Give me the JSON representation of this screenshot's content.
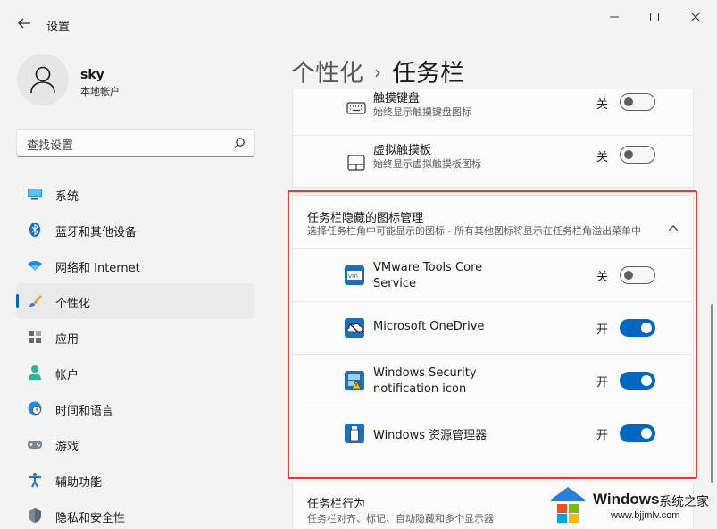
{
  "window": {
    "title": "设置"
  },
  "user": {
    "name": "sky",
    "type": "本地帐户"
  },
  "search": {
    "placeholder": "查找设置"
  },
  "nav": [
    {
      "label": "系统",
      "icon": "monitor-icon"
    },
    {
      "label": "蓝牙和其他设备",
      "icon": "bluetooth-icon"
    },
    {
      "label": "网络和 Internet",
      "icon": "wifi-icon"
    },
    {
      "label": "个性化",
      "icon": "brush-icon",
      "active": true
    },
    {
      "label": "应用",
      "icon": "apps-icon"
    },
    {
      "label": "帐户",
      "icon": "person-icon"
    },
    {
      "label": "时间和语言",
      "icon": "clock-globe-icon"
    },
    {
      "label": "游戏",
      "icon": "gamepad-icon"
    },
    {
      "label": "辅助功能",
      "icon": "accessibility-icon"
    },
    {
      "label": "隐私和安全性",
      "icon": "shield-icon"
    }
  ],
  "breadcrumb": {
    "parent": "个性化",
    "sep": "›",
    "current": "任务栏"
  },
  "top_rows": [
    {
      "title": "触摸键盘",
      "subtitle": "始终显示触摸键盘图标",
      "state": "关",
      "on": false
    },
    {
      "title": "虚拟触摸板",
      "subtitle": "始终显示虚拟触摸板图标",
      "state": "关",
      "on": false
    }
  ],
  "hidden_section": {
    "title": "任务栏隐藏的图标管理",
    "subtitle": "选择任务栏角中可能显示的图标 - 所有其他图标将显示在任务栏角溢出菜单中",
    "items": [
      {
        "title": "VMware Tools Core Service",
        "state": "关",
        "on": false,
        "icon": "vmware-icon"
      },
      {
        "title": "Microsoft OneDrive",
        "state": "开",
        "on": true,
        "icon": "onedrive-icon"
      },
      {
        "title": "Windows Security notification icon",
        "state": "开",
        "on": true,
        "icon": "windows-security-icon"
      },
      {
        "title": "Windows 资源管理器",
        "state": "开",
        "on": true,
        "icon": "usb-drive-icon"
      }
    ]
  },
  "behavior": {
    "title": "任务栏行为",
    "subtitle": "任务栏对齐、标记、自动隐藏和多个显示器"
  },
  "watermark": {
    "brand": "Windows",
    "suffix": "系统之家",
    "url": "www.bjjmlv.com"
  },
  "colors": {
    "accent": "#0067c0",
    "highlight_border": "#e53935"
  }
}
